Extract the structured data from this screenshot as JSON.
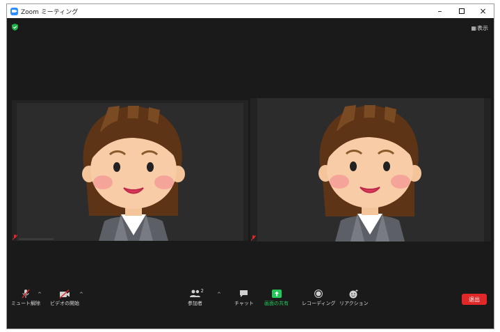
{
  "window": {
    "title": "Zoom ミーティング",
    "controls": {
      "minimize": "–",
      "close": "×"
    }
  },
  "top": {
    "view_label": "表示"
  },
  "participants_tiles": [
    {
      "muted": true
    },
    {
      "muted": true
    }
  ],
  "toolbar": {
    "unmute_label": "ミュート解除",
    "start_video_label": "ビデオの開始",
    "participants_label": "参加者",
    "participants_count": "2",
    "chat_label": "チャット",
    "share_label": "画面の共有",
    "record_label": "レコーディング",
    "reactions_label": "リアクション",
    "leave_label": "退出"
  },
  "colors": {
    "background": "#1a1a1a",
    "share_green": "#21c95a",
    "leave_red": "#e02828",
    "muted_red": "#e02828"
  }
}
